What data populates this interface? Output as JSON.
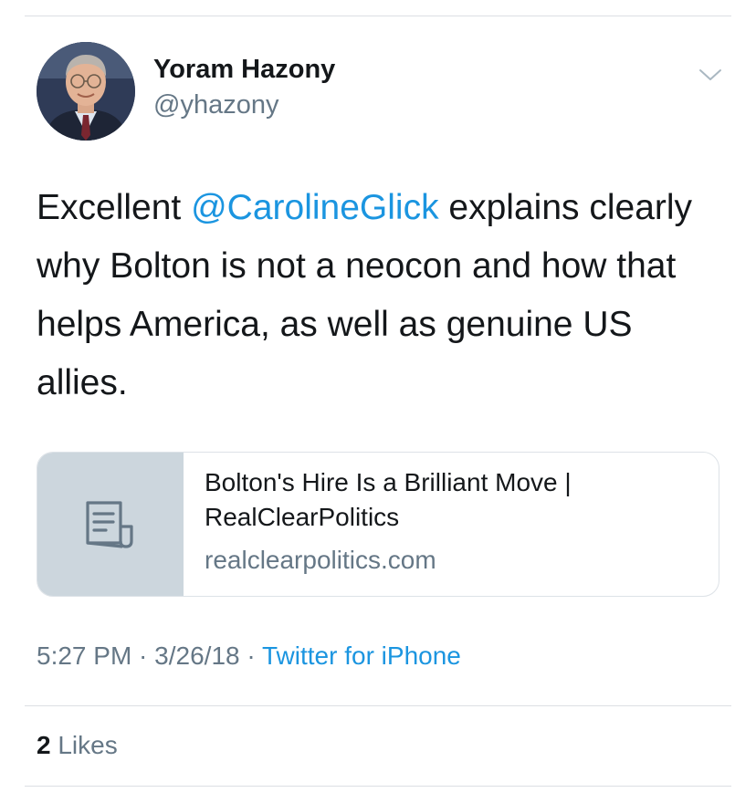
{
  "author": {
    "name": "Yoram Hazony",
    "handle": "@yhazony",
    "avatar_icon": "profile-photo"
  },
  "menu": {
    "icon": "chevron-down-icon"
  },
  "tweet": {
    "text_before": "Excellent ",
    "mention": "@CarolineGlick",
    "text_after": " explains clearly why Bolton is not a neocon and how that helps America, as well as genuine US allies."
  },
  "card": {
    "icon": "document-icon",
    "title": "Bolton's Hire Is a Brilliant Move | RealClearPolitics",
    "domain": "realclearpolitics.com"
  },
  "meta": {
    "time": "5:27 PM",
    "separator": " · ",
    "date": "3/26/18",
    "source": "Twitter for iPhone"
  },
  "stats": {
    "likes_count": "2",
    "likes_label": " Likes"
  },
  "colors": {
    "link_blue": "#1b95e0",
    "secondary_gray": "#657786",
    "text_dark": "#14171a",
    "card_thumb_bg": "#ccd6dd"
  }
}
